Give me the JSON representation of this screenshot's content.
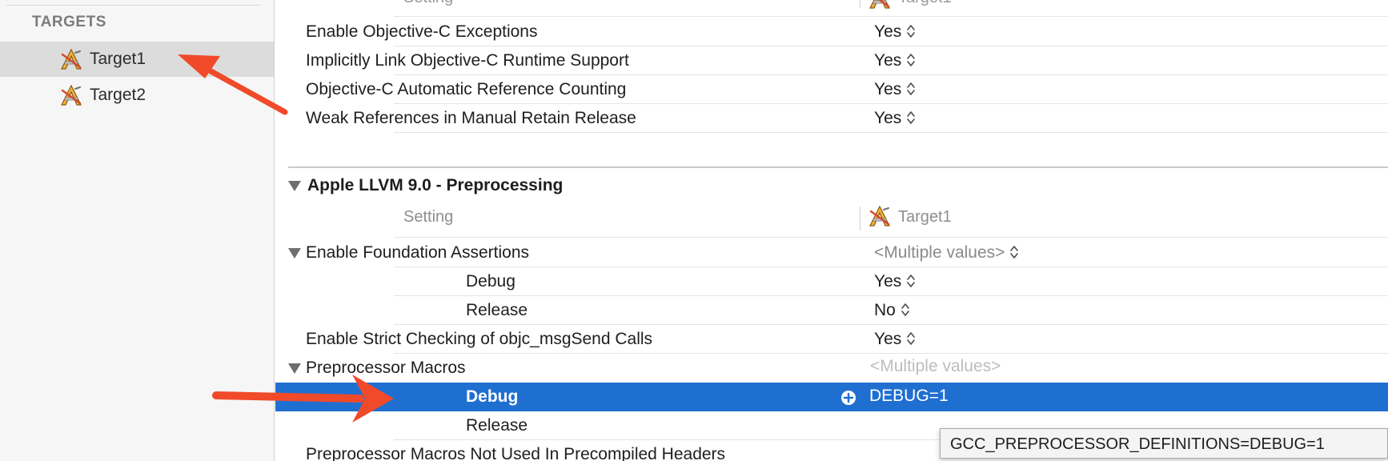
{
  "sidebar": {
    "header": "TARGETS",
    "targets": [
      {
        "label": "Target1",
        "selected": true
      },
      {
        "label": "Target2",
        "selected": false
      }
    ]
  },
  "top_partial": {
    "setting_header": "Setting",
    "target_header": "Target1"
  },
  "objc_rows": [
    {
      "name": "Enable Objective-C Exceptions",
      "value": "Yes"
    },
    {
      "name": "Implicitly Link Objective-C Runtime Support",
      "value": "Yes"
    },
    {
      "name": "Objective-C Automatic Reference Counting",
      "value": "Yes"
    },
    {
      "name": "Weak References in Manual Retain Release",
      "value": "Yes"
    }
  ],
  "preprocessing": {
    "title": "Apple LLVM 9.0 - Preprocessing",
    "setting_header": "Setting",
    "target_header": "Target1",
    "rows": {
      "foundation_assertions": {
        "name": "Enable Foundation Assertions",
        "value": "<Multiple values>"
      },
      "fa_debug": {
        "name": "Debug",
        "value": "Yes"
      },
      "fa_release": {
        "name": "Release",
        "value": "No"
      },
      "strict_checking": {
        "name": "Enable Strict Checking of objc_msgSend Calls",
        "value": "Yes"
      },
      "preprocessor_macros": {
        "name": "Preprocessor Macros",
        "value": "<Multiple values>"
      },
      "pm_debug": {
        "name": "Debug",
        "value": "DEBUG=1"
      },
      "pm_release": {
        "name": "Release",
        "value": ""
      },
      "not_used_precompiled": {
        "name": "Preprocessor Macros Not Used In Precompiled Headers",
        "value": ""
      }
    }
  },
  "tooltip": "GCC_PREPROCESSOR_DEFINITIONS=DEBUG=1",
  "colors": {
    "selection": "#1f6fd1",
    "annotation_arrow": "#f04a2a",
    "sidebar_bg": "#f6f6f6"
  },
  "icons": {
    "target": "xcode-target-icon",
    "stepper": "up-down-chevron-icon",
    "add": "plus-circle-icon",
    "disclosure": "disclosure-triangle-icon"
  }
}
